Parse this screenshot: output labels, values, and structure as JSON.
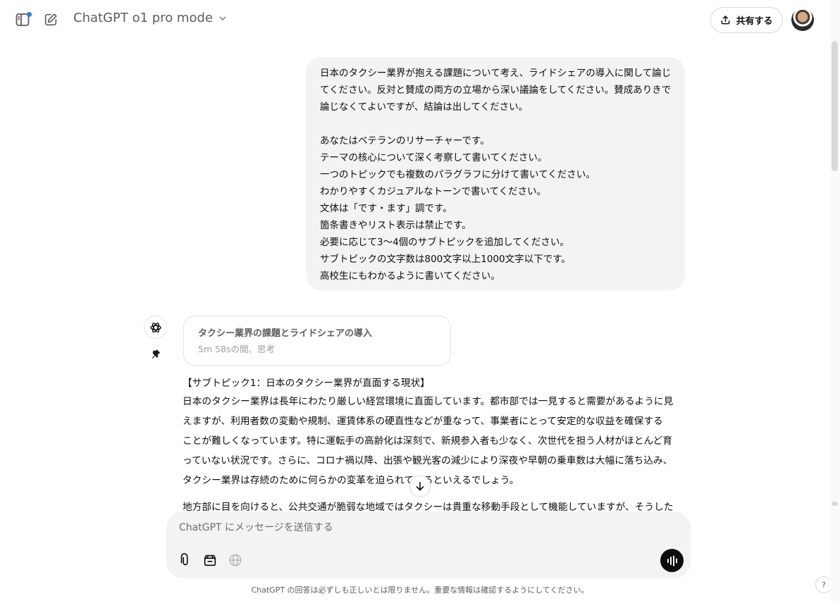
{
  "header": {
    "model_name": "ChatGPT o1 pro mode",
    "share_label": "共有する"
  },
  "conversation": {
    "user_message": {
      "paragraph1": [
        "日本のタクシー業界が抱える課題について考え、ライドシェアの導入に関して論じ",
        "てください。反対と賛成の両方の立場から深い議論をしてください。賛成ありきで",
        "論じなくてよいですが、結論は出してください。"
      ],
      "paragraph2": [
        "あなたはベテランのリサーチャーです。",
        "テーマの核心について深く考察して書いてください。",
        "一つのトピックでも複数のパラグラフに分けて書いてください。",
        "わかりやすくカジュアルなトーンで書いてください。",
        "文体は「です・ます」調です。",
        "箇条書きやリスト表示は禁止です。",
        "必要に応じて3〜4個のサブトピックを追加してください。",
        "サブトピックの文字数は800文字以上1000文字以下です。",
        "高校生にもわかるように書いてください。"
      ]
    },
    "reasoning": {
      "title": "タクシー業界の課題とライドシェアの導入",
      "duration": "5m 58sの間、思考"
    },
    "answer": {
      "heading": "【サブトピック1：日本のタクシー業界が直面する現状】",
      "paragraph1": [
        "日本のタクシー業界は長年にわたり厳しい経営環境に直面しています。都市部では一見すると需要があるように見",
        "えますが、利用者数の変動や規制、運賃体系の硬直性などが重なって、事業者にとって安定的な収益を確保する",
        "ことが難しくなっています。特に運転手の高齢化は深刻で、新規参入者も少なく、次世代を担う人材がほとんど育",
        "っていない状況です。さらに、コロナ禍以降、出張や観光客の減少により深夜や早朝の乗車数は大幅に落ち込み、",
        "タクシー業界は存続のために何らかの変革を迫られているといえるでしょう。"
      ],
      "paragraph2_partial": "地方部に目を向けると、公共交通が脆弱な地域ではタクシーは貴重な移動手段として機能していますが、そうした"
    }
  },
  "composer": {
    "placeholder": "ChatGPT にメッセージを送信する",
    "value": ""
  },
  "footer": {
    "disclaimer": "ChatGPT の回答は必ずしも正しいとは限りません。重要な情報は確認するようにしてください。",
    "help_label": "?"
  },
  "icons": {
    "sidebar": "sidebar-toggle-icon",
    "new_chat": "new-chat-icon",
    "share": "share-icon",
    "gpt": "openai-logo-icon",
    "pin": "pin-icon",
    "scroll_down": "arrow-down-icon",
    "attach": "paperclip-icon",
    "tools": "tools-icon",
    "web": "globe-icon",
    "voice": "voice-wave-icon"
  },
  "colors": {
    "bubble": "#f3f3f3",
    "notification_dot": "#2c7be5",
    "voice_button": "#0d0d0d"
  }
}
